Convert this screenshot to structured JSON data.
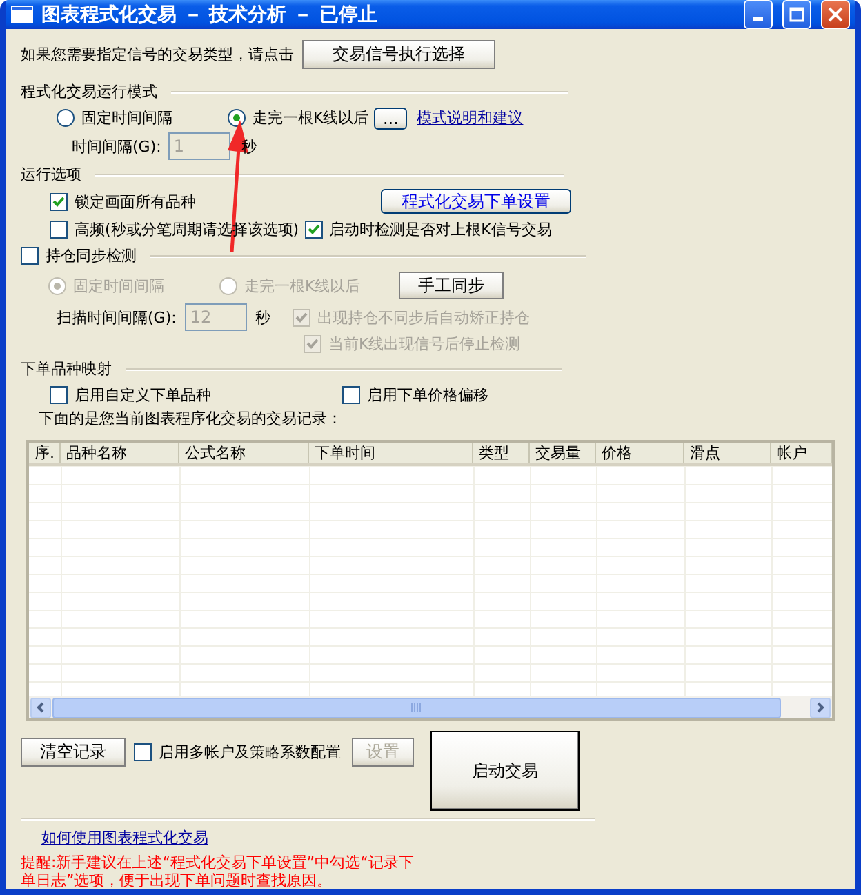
{
  "window": {
    "title": "图表程式化交易 － 技术分析 － 已停止"
  },
  "signal_prompt": {
    "text": "如果您需要指定信号的交易类型，请点击",
    "button": "交易信号执行选择"
  },
  "run_mode": {
    "heading": "程式化交易运行模式",
    "options": [
      {
        "label": "固定时间间隔",
        "selected": false
      },
      {
        "label": "走完一根K线以后",
        "selected": true
      }
    ],
    "more_button": "...",
    "link": "模式说明和建议",
    "interval_label": "时间间隔(G):",
    "interval_value": "1",
    "interval_disabled": true,
    "interval_unit": "秒"
  },
  "run_options": {
    "heading": "运行选项",
    "checks": [
      {
        "label": "锁定画面所有品种",
        "checked": true
      },
      {
        "label": "高频(秒或分笔周期请选择该选项)",
        "checked": false
      },
      {
        "label": "启动时检测是否对上根K信号交易",
        "checked": true
      }
    ],
    "order_settings_button": "程式化交易下单设置"
  },
  "position_sync": {
    "label": "持仓同步检测",
    "checked": false,
    "options_disabled": true,
    "options": [
      {
        "label": "固定时间间隔",
        "selected": true
      },
      {
        "label": "走完一根K线以后",
        "selected": false
      }
    ],
    "manual_sync_button": "手工同步",
    "scan_label": "扫描时间间隔(G):",
    "scan_value": "12",
    "scan_unit": "秒",
    "checks": [
      {
        "label": "出现持仓不同步后自动矫正持仓",
        "checked": true
      },
      {
        "label": "当前K线出现信号后停止检测",
        "checked": true
      }
    ]
  },
  "mapping": {
    "heading": "下单品种映射",
    "checks": [
      {
        "label": "启用自定义下单品种",
        "checked": false
      },
      {
        "label": "启用下单价格偏移",
        "checked": false
      }
    ]
  },
  "records_caption": "下面的是您当前图表程序化交易的交易记录：",
  "table": {
    "columns": [
      "序.",
      "品种名称",
      "公式名称",
      "下单时间",
      "类型",
      "交易量",
      "价格",
      "滑点",
      "帐户"
    ]
  },
  "bottom": {
    "clear_button": "清空记录",
    "multi_account": {
      "label": "启用多帐户及策略系数配置",
      "checked": false
    },
    "settings_button": {
      "label": "设置",
      "disabled": true
    },
    "start_button": "启动交易"
  },
  "help_link": "如何使用图表程式化交易",
  "notice": "提醒:新手建议在上述“程式化交易下单设置”中勾选“记录下单日志”选项，便于出现下单问题时查找原因。"
}
